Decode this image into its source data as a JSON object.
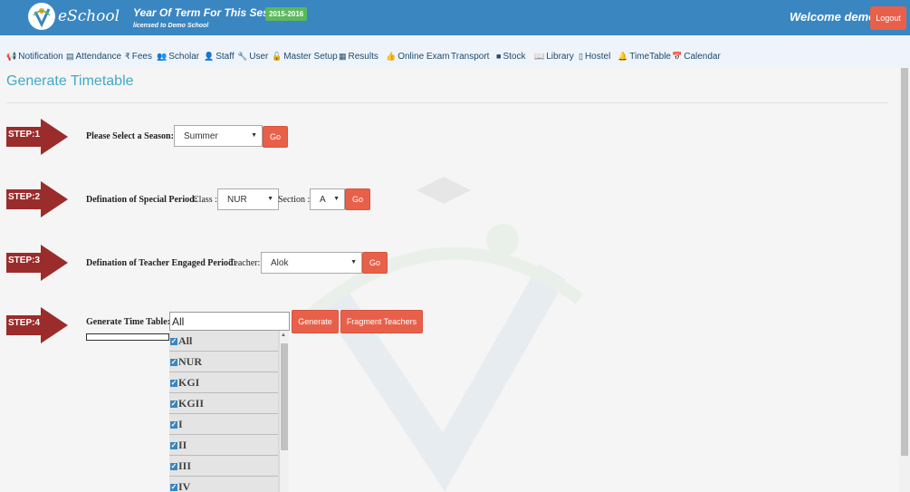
{
  "header": {
    "logo_text": "eSchool",
    "session_label": "Year Of Term For This Session :-",
    "session_value": "2015-2016",
    "licensed": "licensed to Demo School",
    "welcome": "Welcome demo !",
    "logout": "Logout"
  },
  "nav": [
    {
      "label": "Notification",
      "icon": "megaphone-icon",
      "glyph": "📢"
    },
    {
      "label": "Attendance",
      "icon": "document-icon",
      "glyph": "▤"
    },
    {
      "label": "Fees",
      "icon": "rupee-icon",
      "glyph": "₹"
    },
    {
      "label": "Scholar",
      "icon": "users-icon",
      "glyph": "👥"
    },
    {
      "label": "Staff",
      "icon": "user-icon",
      "glyph": "👤"
    },
    {
      "label": "User",
      "icon": "wrench-icon",
      "glyph": "🔧"
    },
    {
      "label": "Master Setup",
      "icon": "unlock-icon",
      "glyph": "🔓"
    },
    {
      "label": "Results",
      "icon": "chart-icon",
      "glyph": "▦"
    },
    {
      "label": "Online Exam",
      "icon": "thumbs-up-icon",
      "glyph": "👍"
    },
    {
      "label": "Transport",
      "icon": "",
      "glyph": ""
    },
    {
      "label": "Stock",
      "icon": "folder-icon",
      "glyph": "■"
    },
    {
      "label": "Library",
      "icon": "book-icon",
      "glyph": "📖"
    },
    {
      "label": "Hostel",
      "icon": "building-icon",
      "glyph": "▯"
    },
    {
      "label": "TimeTable",
      "icon": "bell-icon",
      "glyph": "🔔"
    },
    {
      "label": "Calendar",
      "icon": "calendar-icon",
      "glyph": "📅"
    }
  ],
  "page": {
    "title": "Generate Timetable"
  },
  "steps": [
    {
      "label": "STEP:1"
    },
    {
      "label": "STEP:2"
    },
    {
      "label": "STEP:3"
    },
    {
      "label": "STEP:4"
    }
  ],
  "step1": {
    "label": "Please Select a Season:",
    "season": "Summer",
    "go": "Go"
  },
  "step2": {
    "label": "Defination of Special Period:",
    "class_label": "Class :",
    "class_value": "NUR",
    "section_label": "Section :",
    "section_value": "A",
    "go": "Go"
  },
  "step3": {
    "label": "Defination of Teacher Engaged Period:",
    "teacher_label": "Teacher:",
    "teacher_value": "Alok",
    "go": "Go"
  },
  "step4": {
    "label": "Generate Time Table:",
    "input_value": "All",
    "generate": "Generate",
    "fragment": "Fragment Teachers",
    "options": [
      "All",
      "NUR",
      "KGI",
      "KGII",
      "I",
      "II",
      "III",
      "IV"
    ]
  },
  "colors": {
    "primary": "#3a86c0",
    "accent": "#e8604a",
    "step_arrow": "#9b2c2c",
    "title": "#42a9c9"
  }
}
